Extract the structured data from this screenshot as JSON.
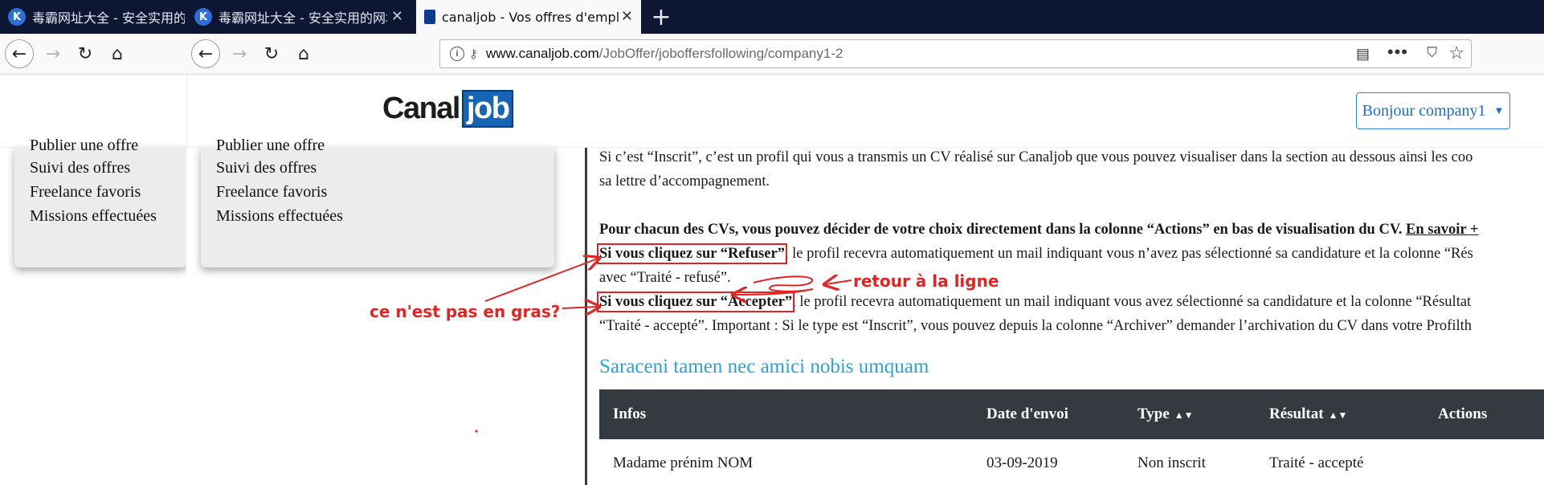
{
  "browser": {
    "tabs": [
      {
        "label": "毒霸网址大全 - 安全实用的网",
        "icon": "k-icon"
      },
      {
        "label": "毒霸网址大全 - 安全实用的网址",
        "icon": "k-icon"
      },
      {
        "label": "canaljob - Vos offres d'emploi",
        "icon": "canaljob-icon",
        "active": true
      }
    ],
    "url_host": "www.canaljob.com",
    "url_path": "/JobOffer/joboffersfollowing/company1-2"
  },
  "header": {
    "logo_part1": "Canal",
    "logo_part2": "job",
    "user_button": "Bonjour company1"
  },
  "menu": {
    "items": [
      "Publier une offre",
      "Suivi des offres",
      "Freelance favoris",
      "Missions effectuées"
    ]
  },
  "content": {
    "line1": "Si c’est “Inscrit”, c’est un profil qui vous a transmis un CV réalisé sur Canaljob que vous pouvez visualiser dans la section au dessous ainsi les coo",
    "line2": "sa lettre d’accompagnement.",
    "bold_line": "Pour chacun des CVs, vous pouvez décider de votre choix directement dans la colonne “Actions” en bas de visualisation du CV.",
    "bold_link": "En savoir +",
    "refuser_bold": "Si vous cliquez sur “Refuser”",
    "refuser_rest": ", le profil recevra automatiquement un mail indiquant vous n’avez pas sélectionné sa candidature et la colonne “Rés",
    "refuser_line2": "avec “Traité - refusé”.",
    "accepter_bold": "Si vous cliquez sur “Accepter”",
    "accepter_rest": ", le profil recevra automatiquement un mail indiquant vous avez sélectionné sa candidature et la colonne “Résultat",
    "accepter_line2": "“Traité - accepté”. Important : Si le type est “Inscrit”, vous pouvez depuis la colonne “Archiver” demander l’archivation du CV dans votre Profilth",
    "section_title": "Saraceni tamen nec amici nobis umquam"
  },
  "table": {
    "headers": {
      "infos": "Infos",
      "date": "Date d'envoi",
      "type": "Type",
      "resultat": "Résultat",
      "actions": "Actions"
    },
    "rows": [
      {
        "infos": "Madame prénim NOM",
        "date": "03-09-2019",
        "type": "Non inscrit",
        "resultat": "Traité - accepté"
      }
    ]
  },
  "annotations": {
    "retour": "retour à la ligne",
    "gras": "ce n'est pas en gras?",
    "color": "#e02424"
  }
}
